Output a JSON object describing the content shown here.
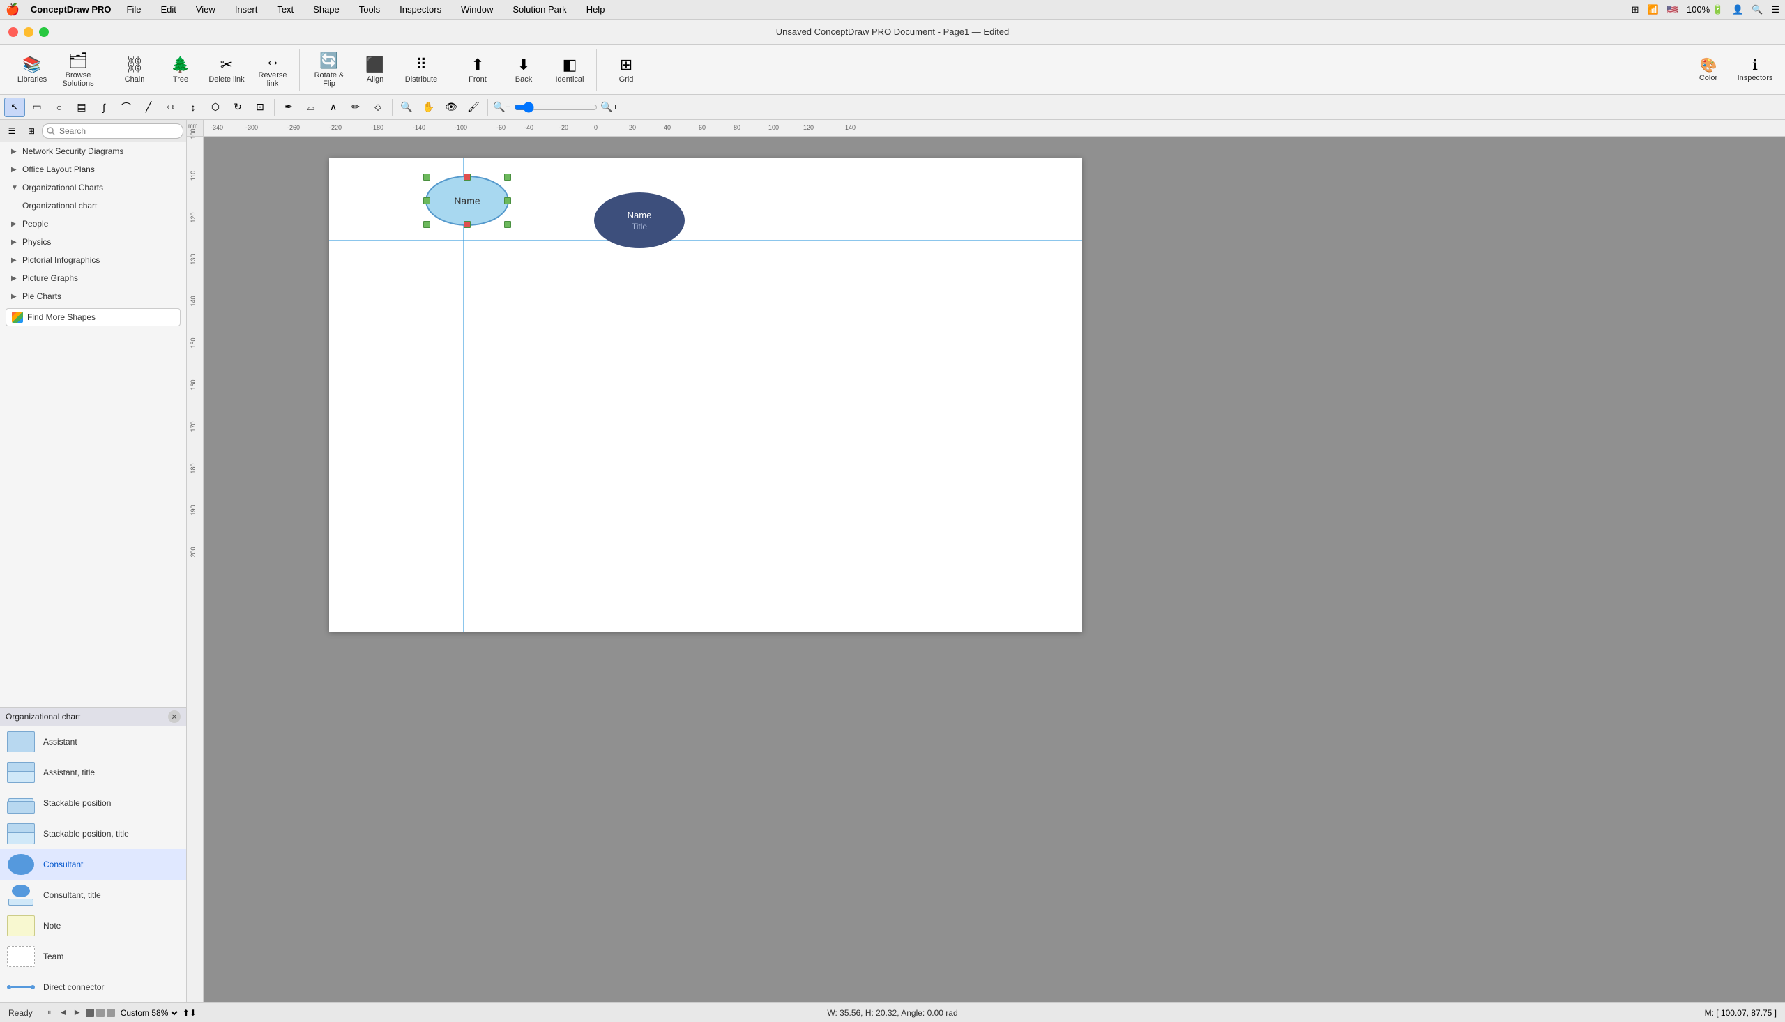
{
  "menubar": {
    "app_name": "ConceptDraw PRO",
    "apple_icon": "🍎",
    "menus": [
      "File",
      "Edit",
      "View",
      "Insert",
      "Text",
      "Shape",
      "Tools",
      "Inspectors",
      "Window",
      "Solution Park",
      "Help"
    ],
    "right": {
      "battery": "100%",
      "wifi": "wifi",
      "time": "100%"
    }
  },
  "titlebar": {
    "title": "Unsaved ConceptDraw PRO Document - Page1 — Edited"
  },
  "toolbar": {
    "libraries_label": "Libraries",
    "browse_label": "Browse Solutions",
    "chain_label": "Chain",
    "tree_label": "Tree",
    "delete_link_label": "Delete link",
    "reverse_link_label": "Reverse link",
    "rotate_flip_label": "Rotate & Flip",
    "align_label": "Align",
    "distribute_label": "Distribute",
    "front_label": "Front",
    "back_label": "Back",
    "identical_label": "Identical",
    "grid_label": "Grid",
    "color_label": "Color",
    "inspectors_label": "Inspectors"
  },
  "panel": {
    "search_placeholder": "Search",
    "library_items": [
      {
        "id": "network",
        "label": "Network Security Diagrams",
        "expanded": false
      },
      {
        "id": "office",
        "label": "Office Layout Plans",
        "expanded": false
      },
      {
        "id": "org",
        "label": "Organizational Charts",
        "expanded": true
      },
      {
        "id": "org-chart",
        "label": "Organizational chart",
        "sub": true
      },
      {
        "id": "people",
        "label": "People",
        "expanded": false
      },
      {
        "id": "physics",
        "label": "Physics",
        "expanded": false
      },
      {
        "id": "pictorial",
        "label": "Pictorial Infographics",
        "expanded": false
      },
      {
        "id": "picture",
        "label": "Picture Graphs",
        "expanded": false
      },
      {
        "id": "pie",
        "label": "Pie Charts",
        "expanded": false
      }
    ],
    "find_more": "Find More Shapes",
    "active_library": "Organizational chart",
    "shapes": [
      {
        "id": "assistant",
        "label": "Assistant"
      },
      {
        "id": "assistant-title",
        "label": "Assistant, title"
      },
      {
        "id": "stackable",
        "label": "Stackable position"
      },
      {
        "id": "stackable-title",
        "label": "Stackable position, title"
      },
      {
        "id": "consultant",
        "label": "Consultant",
        "active": true
      },
      {
        "id": "consultant-title",
        "label": "Consultant, title"
      },
      {
        "id": "note",
        "label": "Note"
      },
      {
        "id": "team",
        "label": "Team"
      },
      {
        "id": "connector",
        "label": "Direct connector"
      }
    ]
  },
  "canvas": {
    "zoom": "Custom 58%",
    "unit": "mm",
    "shape_selected": {
      "label": "Name"
    },
    "shape_dark": {
      "name": "Name",
      "title": "Title"
    },
    "status_ready": "Ready",
    "status_dimensions": "W: 35.56,  H: 20.32,  Angle: 0.00 rad",
    "status_coordinates": "M: [ 100.07, 87.75 ]"
  }
}
